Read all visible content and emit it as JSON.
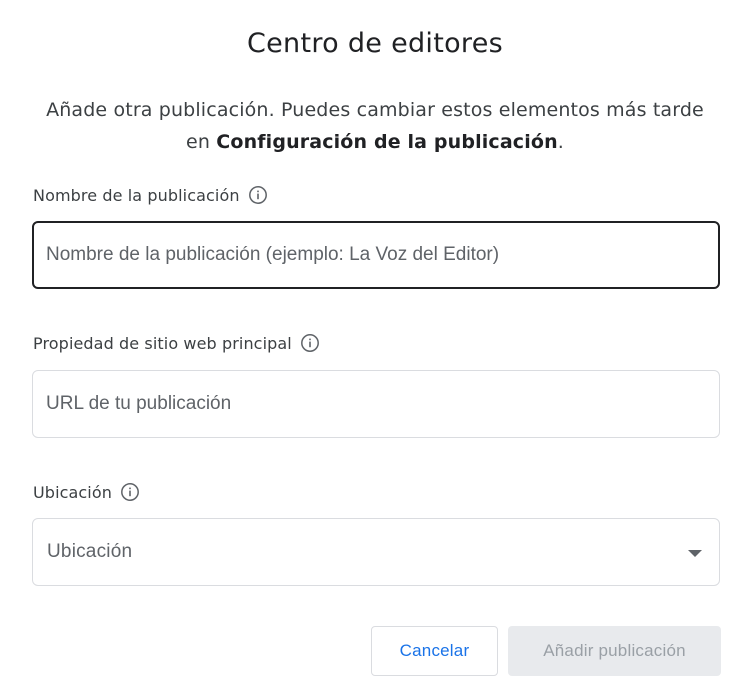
{
  "dialog": {
    "title": "Centro de editores",
    "intro_text": "Añade otra publicación. Puedes cambiar estos elementos más tarde en ",
    "intro_bold": "Configuración de la publicación",
    "intro_end": "."
  },
  "fields": {
    "name": {
      "label": "Nombre de la publicación",
      "placeholder": "Nombre de la publicación (ejemplo: La Voz del Editor)",
      "value": ""
    },
    "website": {
      "label": "Propiedad de sitio web principal",
      "placeholder": "URL de tu publicación",
      "value": ""
    },
    "location": {
      "label": "Ubicación",
      "selected": "Ubicación"
    }
  },
  "buttons": {
    "cancel": "Cancelar",
    "add": "Añadir publicación"
  },
  "icons": {
    "info": "info-outline-icon",
    "dropdown": "arrow-drop-down-icon"
  },
  "colors": {
    "accent": "#1a73e8",
    "focused_border": "#202124",
    "border": "#dadce0",
    "disabled_bg": "#e8eaed",
    "disabled_text": "#9aa0a6"
  }
}
